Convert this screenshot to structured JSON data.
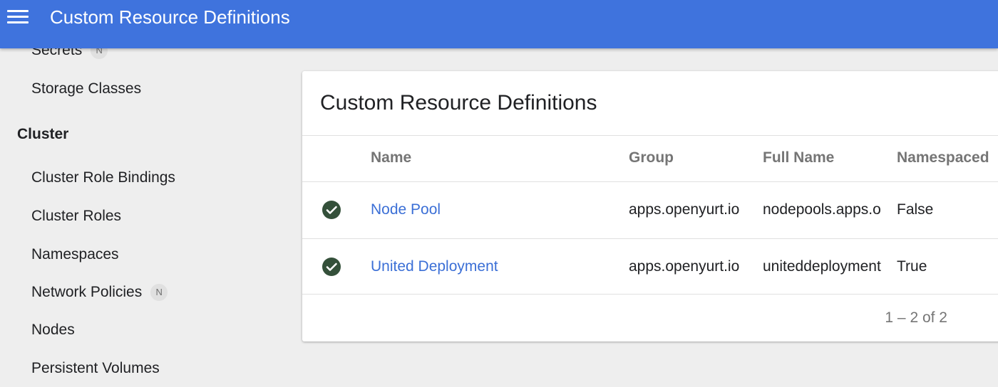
{
  "header": {
    "menu_icon": "hamburger-menu-icon",
    "title": "Custom Resource Definitions"
  },
  "sidebar": {
    "items": [
      {
        "label": "Secrets",
        "badge": "N"
      },
      {
        "label": "Storage Classes"
      },
      {
        "section": "Cluster"
      },
      {
        "label": "Cluster Role Bindings"
      },
      {
        "label": "Cluster Roles"
      },
      {
        "label": "Namespaces"
      },
      {
        "label": "Network Policies",
        "badge": "N"
      },
      {
        "label": "Nodes"
      },
      {
        "label": "Persistent Volumes"
      }
    ]
  },
  "card": {
    "title": "Custom Resource Definitions",
    "columns": [
      "Name",
      "Group",
      "Full Name",
      "Namespaced"
    ],
    "rows": [
      {
        "status_icon": "check-circle-icon",
        "name": "Node Pool",
        "group": "apps.openyurt.io",
        "full_name": "nodepools.apps.o",
        "namespaced": "False"
      },
      {
        "status_icon": "check-circle-icon",
        "name": "United Deployment",
        "group": "apps.openyurt.io",
        "full_name": "uniteddeployment",
        "namespaced": "True"
      }
    ],
    "pagination": "1 – 2 of 2"
  },
  "colors": {
    "topbar": "#3f73dd",
    "link": "#3b6fd6",
    "status_ok": "#34503a"
  }
}
